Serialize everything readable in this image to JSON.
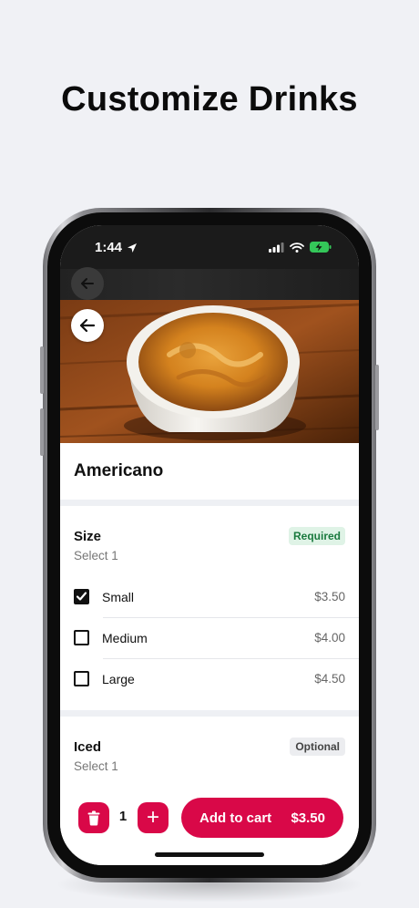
{
  "headline": "Customize Drinks",
  "status_bar": {
    "time": "1:44"
  },
  "product": {
    "name": "Americano"
  },
  "size_section": {
    "title": "Size",
    "badge": "Required",
    "subtitle": "Select 1",
    "options": [
      {
        "label": "Small",
        "price": "$3.50",
        "checked": true
      },
      {
        "label": "Medium",
        "price": "$4.00",
        "checked": false
      },
      {
        "label": "Large",
        "price": "$4.50",
        "checked": false
      }
    ]
  },
  "iced_section": {
    "title": "Iced",
    "badge": "Optional",
    "subtitle": "Select 1"
  },
  "bottom_bar": {
    "quantity": "1",
    "plus_symbol": "+",
    "add_to_cart_label": "Add to cart",
    "total_price": "$3.50"
  },
  "colors": {
    "accent": "#d90848",
    "required_green": "#1a7a3e",
    "background": "#f0f1f5"
  }
}
